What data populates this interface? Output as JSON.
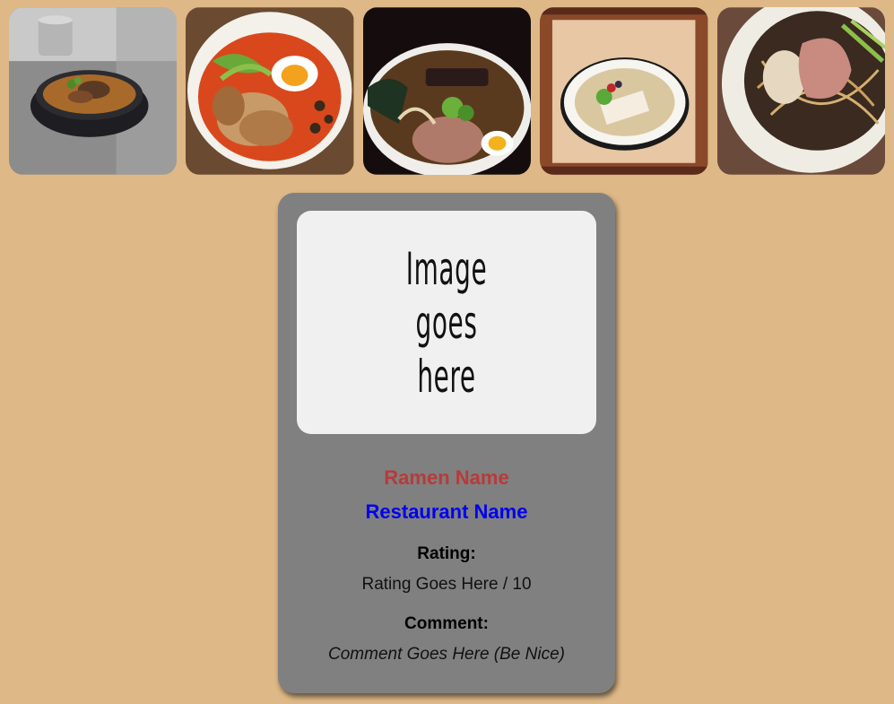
{
  "ramen_menu": {
    "items": [
      {
        "image": "ramen-bowl-dark-icon"
      },
      {
        "image": "ramen-bowl-spicy-icon"
      },
      {
        "image": "ramen-bowl-naruto-icon"
      },
      {
        "image": "ramen-bowl-tofu-icon"
      },
      {
        "image": "ramen-bowl-chashu-icon"
      }
    ]
  },
  "detail": {
    "image_placeholder": "Image goes here",
    "ramen_name": "Ramen Name",
    "restaurant_name": "Restaurant Name",
    "rating_label": "Rating:",
    "rating_value": "Rating Goes Here / 10",
    "comment_label": "Comment:",
    "comment_value": "Comment Goes Here (Be Nice)"
  },
  "colors": {
    "background": "#deb887",
    "card": "#808080",
    "ramen_name": "#b83a3a",
    "restaurant_name": "#0000ee"
  }
}
